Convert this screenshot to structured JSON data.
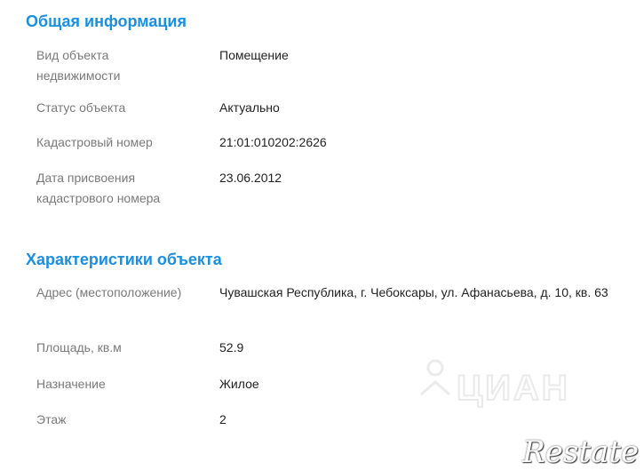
{
  "general": {
    "title": "Общая информация",
    "rows": [
      {
        "label": "Вид объекта недвижимости",
        "value": "Помещение"
      },
      {
        "label": "Статус объекта",
        "value": "Актуально"
      },
      {
        "label": "Кадастровый номер",
        "value": "21:01:010202:2626"
      },
      {
        "label": "Дата присвоения кадастрового номера",
        "value": "23.06.2012"
      }
    ]
  },
  "characteristics": {
    "title": "Характеристики объекта",
    "rows": [
      {
        "label": "Адрес (местоположение)",
        "value": "Чувашская Республика, г. Чебоксары, ул. Афанасьева, д. 10, кв. 63"
      },
      {
        "label": "Площадь, кв.м",
        "value": "52.9"
      },
      {
        "label": "Назначение",
        "value": "Жилое"
      },
      {
        "label": "Этаж",
        "value": "2"
      }
    ]
  },
  "watermarks": {
    "cian": "ЦИАН",
    "restate": "Restate"
  }
}
